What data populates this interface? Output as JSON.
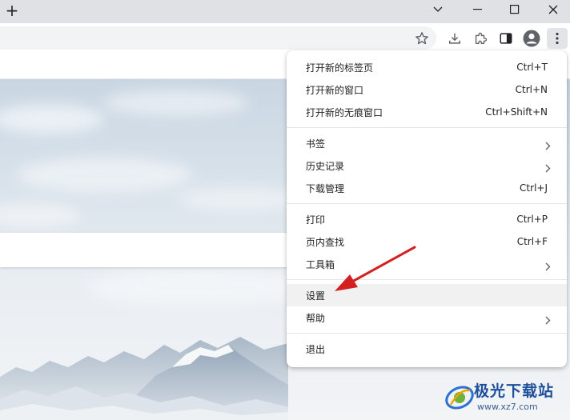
{
  "titlebar": {
    "new_tab_glyph": "+",
    "icons": [
      "tab-search-chevron-icon",
      "minimize-icon",
      "maximize-icon",
      "close-icon"
    ]
  },
  "toolbar": {
    "icons": [
      "star-icon",
      "download-icon",
      "extensions-icon",
      "side-panel-icon",
      "profile-icon",
      "kebab-menu-icon"
    ]
  },
  "menu": {
    "items": [
      {
        "label": "打开新的标签页",
        "shortcut": "Ctrl+T"
      },
      {
        "label": "打开新的窗口",
        "shortcut": "Ctrl+N"
      },
      {
        "label": "打开新的无痕窗口",
        "shortcut": "Ctrl+Shift+N"
      },
      {
        "label": "书签",
        "shortcut": ""
      },
      {
        "label": "历史记录",
        "shortcut": ""
      },
      {
        "label": "下载管理",
        "shortcut": "Ctrl+J"
      },
      {
        "label": "打印",
        "shortcut": "Ctrl+P"
      },
      {
        "label": "页内查找",
        "shortcut": "Ctrl+F"
      },
      {
        "label": "工具箱",
        "shortcut": ""
      },
      {
        "label": "设置",
        "shortcut": ""
      },
      {
        "label": "帮助",
        "shortcut": ""
      },
      {
        "label": "退出",
        "shortcut": ""
      }
    ],
    "highlighted": "设置",
    "submenu_items": [
      "书签",
      "历史记录",
      "工具箱",
      "帮助"
    ]
  },
  "watermark": {
    "text": "极光下载站",
    "url": "www.xz7.com"
  },
  "colors": {
    "accent_arrow": "#d42020",
    "menu_highlight": "#f1f1f1",
    "watermark": "#1d4f9a"
  }
}
